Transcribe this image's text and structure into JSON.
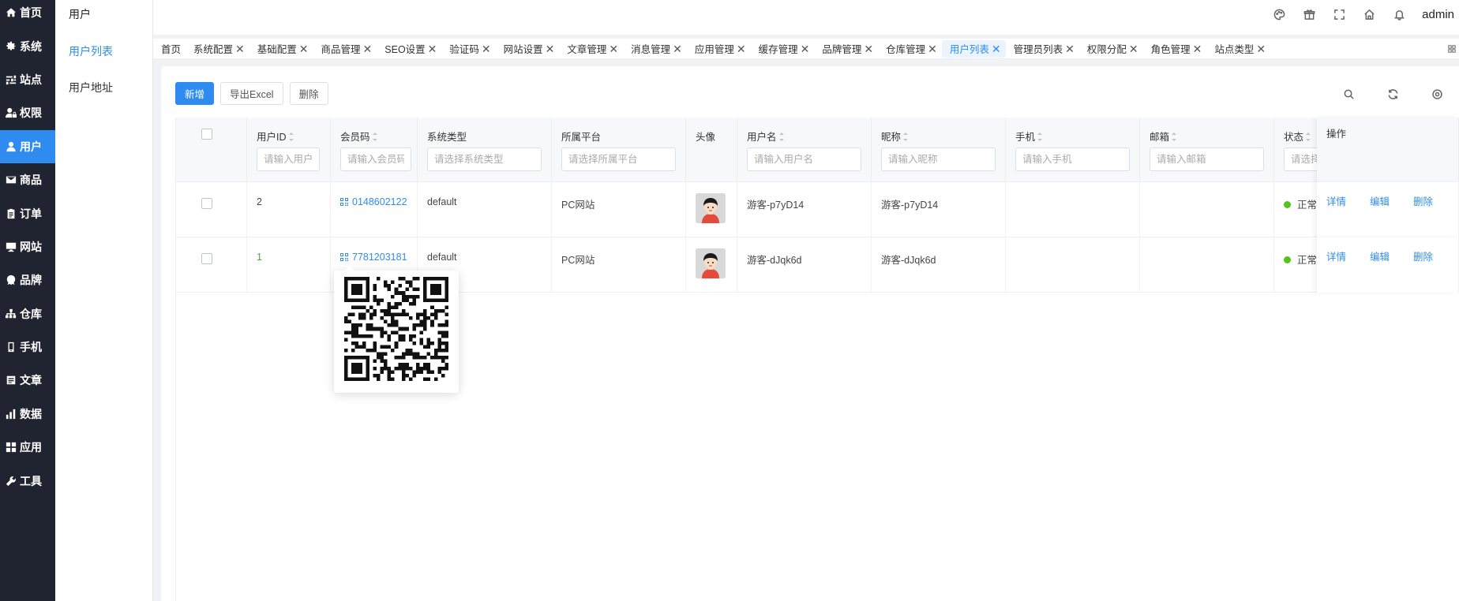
{
  "sidebar": {
    "items": [
      {
        "label": "首页",
        "icon": "home-icon"
      },
      {
        "label": "系统",
        "icon": "gear-icon"
      },
      {
        "label": "站点",
        "icon": "sliders-icon"
      },
      {
        "label": "权限",
        "icon": "user-lock-icon"
      },
      {
        "label": "用户",
        "icon": "user-icon",
        "active": true
      },
      {
        "label": "商品",
        "icon": "mail-icon"
      },
      {
        "label": "订单",
        "icon": "clipboard-icon"
      },
      {
        "label": "网站",
        "icon": "monitor-icon"
      },
      {
        "label": "品牌",
        "icon": "badge-icon"
      },
      {
        "label": "仓库",
        "icon": "sitemap-icon"
      },
      {
        "label": "手机",
        "icon": "mobile-icon"
      },
      {
        "label": "文章",
        "icon": "document-icon"
      },
      {
        "label": "数据",
        "icon": "bar-chart-icon"
      },
      {
        "label": "应用",
        "icon": "apps-icon"
      },
      {
        "label": "工具",
        "icon": "wrench-icon"
      }
    ],
    "active_color": "#2e8bf0"
  },
  "submenu": {
    "title": "用户",
    "items": [
      {
        "label": "用户列表",
        "active": true
      },
      {
        "label": "用户地址",
        "active": false
      }
    ]
  },
  "header": {
    "icons": [
      "palette-icon",
      "gift-icon",
      "fullscreen-icon",
      "home-icon",
      "bell-icon"
    ],
    "username": "admin"
  },
  "tabs": [
    {
      "label": "首页",
      "closable": false
    },
    {
      "label": "系统配置",
      "closable": true
    },
    {
      "label": "基础配置",
      "closable": true
    },
    {
      "label": "商品管理",
      "closable": true
    },
    {
      "label": "SEO设置",
      "closable": true
    },
    {
      "label": "验证码",
      "closable": true
    },
    {
      "label": "网站设置",
      "closable": true
    },
    {
      "label": "文章管理",
      "closable": true
    },
    {
      "label": "消息管理",
      "closable": true
    },
    {
      "label": "应用管理",
      "closable": true
    },
    {
      "label": "缓存管理",
      "closable": true
    },
    {
      "label": "品牌管理",
      "closable": true
    },
    {
      "label": "仓库管理",
      "closable": true
    },
    {
      "label": "用户列表",
      "closable": true,
      "active": true
    },
    {
      "label": "管理员列表",
      "closable": true
    },
    {
      "label": "权限分配",
      "closable": true
    },
    {
      "label": "角色管理",
      "closable": true
    },
    {
      "label": "站点类型",
      "closable": true
    }
  ],
  "toolbar": {
    "add_label": "新增",
    "export_label": "导出Excel",
    "delete_label": "删除",
    "right_icons": [
      "search-icon",
      "refresh-icon",
      "settings-icon"
    ]
  },
  "table": {
    "columns": {
      "user_id": {
        "label": "用户ID",
        "placeholder": "请输入用户ID"
      },
      "member_code": {
        "label": "会员码",
        "placeholder": "请输入会员码"
      },
      "system_type": {
        "label": "系统类型",
        "placeholder": "请选择系统类型"
      },
      "platform": {
        "label": "所属平台",
        "placeholder": "请选择所属平台"
      },
      "avatar": {
        "label": "头像"
      },
      "username": {
        "label": "用户名",
        "placeholder": "请输入用户名"
      },
      "nickname": {
        "label": "昵称",
        "placeholder": "请输入昵称"
      },
      "phone": {
        "label": "手机",
        "placeholder": "请输入手机"
      },
      "email": {
        "label": "邮箱",
        "placeholder": "请输入邮箱"
      },
      "status": {
        "label": "状态",
        "placeholder": "请选择"
      },
      "actions": {
        "label": "操作"
      }
    },
    "rows": [
      {
        "id": "2",
        "code": "0148602122",
        "system": "default",
        "platform": "PC网站",
        "username": "游客-p7yD14",
        "nickname": "游客-p7yD14",
        "phone": "",
        "email": "",
        "status": "正常",
        "id_color": "#444"
      },
      {
        "id": "1",
        "code": "7781203181",
        "system": "default",
        "platform": "PC网站",
        "username": "游客-dJqk6d",
        "nickname": "游客-dJqk6d",
        "phone": "",
        "email": "",
        "status": "正常",
        "id_color": "#52a34a"
      }
    ],
    "actions": {
      "detail": "详情",
      "edit": "编辑",
      "delete": "删除"
    }
  }
}
